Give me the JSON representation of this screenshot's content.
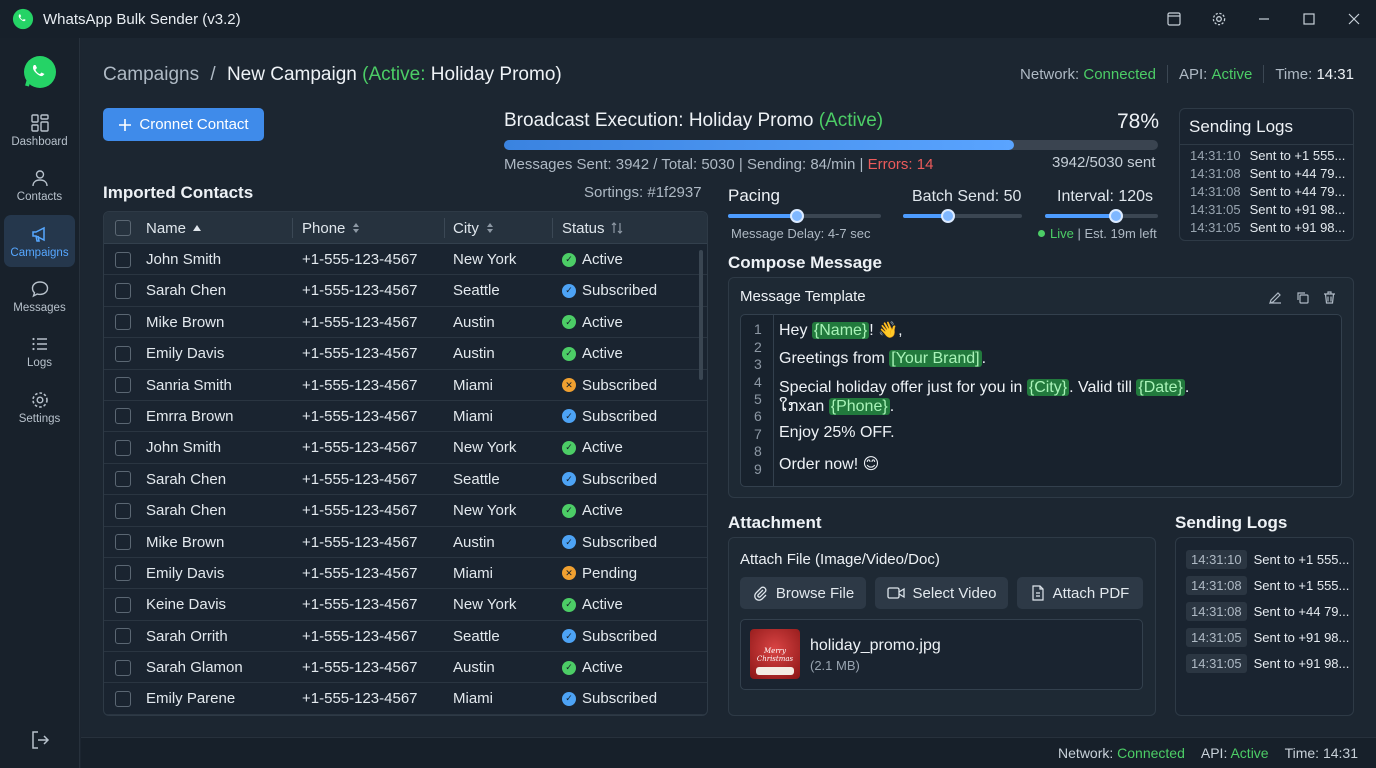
{
  "app": {
    "title": "WhatsApp Bulk Sender (v3.2)"
  },
  "colors": {
    "accent": "#3f8bea",
    "success": "#4ccd66",
    "error": "#ec5b5b",
    "warning": "#f0a030"
  },
  "sidebar": {
    "items": [
      {
        "label": "Dashboard",
        "icon": "dashboard-icon"
      },
      {
        "label": "Contacts",
        "icon": "contacts-icon"
      },
      {
        "label": "Campaigns",
        "icon": "megaphone-icon",
        "active": true
      },
      {
        "label": "Messages",
        "icon": "chat-icon"
      },
      {
        "label": "Logs",
        "icon": "list-icon"
      },
      {
        "label": "Settings",
        "icon": "gear-icon"
      }
    ]
  },
  "breadcrumb": {
    "parent": "Campaigns",
    "sep": "/",
    "current": "New Campaign",
    "active_prefix": "(Active:",
    "active_name": "Holiday Promo)"
  },
  "status": {
    "network_label": "Network:",
    "network_value": "Connected",
    "api_label": "API:",
    "api_value": "Active",
    "time_label": "Time:",
    "time_value": "14:31"
  },
  "actions": {
    "add_contact": "Cronnet Contact"
  },
  "contacts": {
    "title": "Imported Contacts",
    "sortings": "Sortings: #1f2937",
    "columns": [
      "Name",
      "Phone",
      "City",
      "Status"
    ],
    "rows": [
      {
        "name": "John Smith",
        "phone": "+1-555-123-4567",
        "city": "New York",
        "status": "Active",
        "kind": "active"
      },
      {
        "name": "Sarah Chen",
        "phone": "+1-555-123-4567",
        "city": "Seattle",
        "status": "Subscribed",
        "kind": "subscribed"
      },
      {
        "name": "Mike Brown",
        "phone": "+1-555-123-4567",
        "city": "Austin",
        "status": "Active",
        "kind": "active"
      },
      {
        "name": "Emily Davis",
        "phone": "+1-555-123-4567",
        "city": "Austin",
        "status": "Active",
        "kind": "active"
      },
      {
        "name": "Sanria Smith",
        "phone": "+1-555-123-4567",
        "city": "Miami",
        "status": "Subscribed",
        "kind": "pending"
      },
      {
        "name": "Emrra Brown",
        "phone": "+1-555-123-4567",
        "city": "Miami",
        "status": "Subscribed",
        "kind": "subscribed"
      },
      {
        "name": "John Smith",
        "phone": "+1-555-123-4567",
        "city": "New York",
        "status": "Active",
        "kind": "active"
      },
      {
        "name": "Sarah Chen",
        "phone": "+1-555-123-4567",
        "city": "Seattle",
        "status": "Subscribed",
        "kind": "subscribed"
      },
      {
        "name": "Sarah Chen",
        "phone": "+1-555-123-4567",
        "city": "New York",
        "status": "Active",
        "kind": "active"
      },
      {
        "name": "Mike Brown",
        "phone": "+1-555-123-4567",
        "city": "Austin",
        "status": "Subscribed",
        "kind": "subscribed"
      },
      {
        "name": "Emily Davis",
        "phone": "+1-555-123-4567",
        "city": "Miami",
        "status": "Pending",
        "kind": "pending"
      },
      {
        "name": "Keine Davis",
        "phone": "+1-555-123-4567",
        "city": "New York",
        "status": "Active",
        "kind": "active"
      },
      {
        "name": "Sarah Orrith",
        "phone": "+1-555-123-4567",
        "city": "Seattle",
        "status": "Subscribed",
        "kind": "subscribed"
      },
      {
        "name": "Sarah Glamon",
        "phone": "+1-555-123-4567",
        "city": "Austin",
        "status": "Active",
        "kind": "active"
      },
      {
        "name": "Emily Parene",
        "phone": "+1-555-123-4567",
        "city": "Miami",
        "status": "Subscribed",
        "kind": "subscribed"
      }
    ]
  },
  "broadcast": {
    "title": "Broadcast Execution: Holiday Promo",
    "title_active": "(Active)",
    "percent": "78%",
    "progress": 0.78,
    "stats": "Messages Sent: 3942 / Total: 5030 | Sending: 84/min |",
    "errors": "Errors: 14",
    "sent": "3942/5030 sent"
  },
  "pacing": {
    "title": "Pacing",
    "batch": "Batch Send: 50",
    "interval": "Interval: 120s",
    "delay": "Message Delay: 4-7 sec",
    "live": "Live",
    "est": "| Est. 19m left",
    "pacing_level": 0.45,
    "batch_level": 0.38,
    "interval_level": 0.63
  },
  "logs_top": {
    "title": "Sending Logs",
    "entries": [
      {
        "time": "14:31:10",
        "msg": "Sent to +1 555..."
      },
      {
        "time": "14:31:08",
        "msg": "Sent to +44 79..."
      },
      {
        "time": "14:31:08",
        "msg": "Sent to +44 79..."
      },
      {
        "time": "14:31:05",
        "msg": "Sent to +91 98..."
      },
      {
        "time": "14:31:05",
        "msg": "Sent to +91 98..."
      }
    ]
  },
  "compose": {
    "title": "Compose Message",
    "template_label": "Message Template",
    "line_numbers": [
      "1",
      "2",
      "3",
      "4",
      "5",
      "6",
      "7",
      "8",
      "9"
    ],
    "l1a": "Hey ",
    "l1tok": "{Name}",
    "l1b": "! 👋,",
    "l2a": "Greetings from ",
    "l2tok": "[Your Brand]",
    "l2b": ".",
    "l3a": "Special holiday offer just for you in ",
    "l3tok": "{City}",
    "l3b": ". Valid till ",
    "l3tok2": "{Date}",
    "l3c": ".",
    "l4a": "ໃກxan ",
    "l4tok": "{Phone}",
    "l4b": ".",
    "l5": "Enjoy 25% OFF.",
    "l6": "Order now! 😊"
  },
  "attachment": {
    "title": "Attachment",
    "label": "Attach File (Image/Video/Doc)",
    "browse": "Browse File",
    "video": "Select Video",
    "pdf": "Attach PDF",
    "file_name": "holiday_promo.jpg",
    "file_size": "(2.1 MB)",
    "thumb_text": "Merry Christmas"
  },
  "logs_bottom": {
    "title": "Sending Logs",
    "entries": [
      {
        "time": "14:31:10",
        "msg": "Sent to +1 555..."
      },
      {
        "time": "14:31:08",
        "msg": "Sent to +1 555..."
      },
      {
        "time": "14:31:08",
        "msg": "Sent to +44 79..."
      },
      {
        "time": "14:31:05",
        "msg": "Sent to +91 98..."
      },
      {
        "time": "14:31:05",
        "msg": "Sent to +91 98..."
      }
    ]
  },
  "footer": {
    "network_label": "Network:",
    "network_value": "Connected",
    "api_label": "API:",
    "api_value": "Active",
    "time": "Time: 14:31"
  }
}
